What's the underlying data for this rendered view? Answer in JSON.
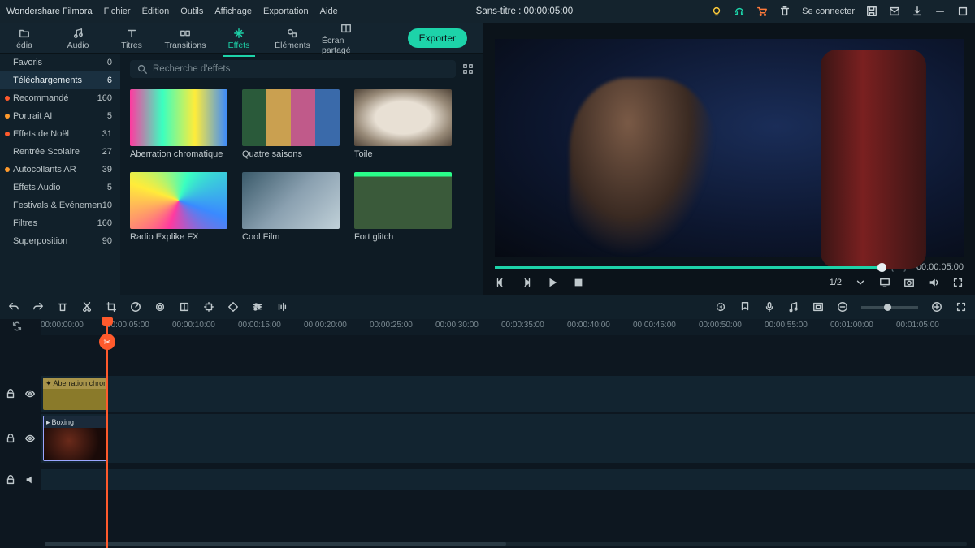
{
  "titlebar": {
    "app_name": "Wondershare Filmora",
    "menu": [
      "Fichier",
      "Édition",
      "Outils",
      "Affichage",
      "Exportation",
      "Aide"
    ],
    "doc_title": "Sans-titre : 00:00:05:00",
    "connect_label": "Se connecter"
  },
  "media_tabs": [
    {
      "label": "édia",
      "icon": "folder"
    },
    {
      "label": "Audio",
      "icon": "music"
    },
    {
      "label": "Titres",
      "icon": "text"
    },
    {
      "label": "Transitions",
      "icon": "transition"
    },
    {
      "label": "Effets",
      "icon": "sparkle",
      "active": true
    },
    {
      "label": "Éléments",
      "icon": "shapes"
    },
    {
      "label": "Écran partagé",
      "icon": "split"
    }
  ],
  "export_label": "Exporter",
  "search_placeholder": "Recherche d'effets",
  "sidebar": [
    {
      "label": "Favoris",
      "count": 0
    },
    {
      "label": "Téléchargements",
      "count": 6,
      "active": true
    },
    {
      "label": "Recommandé",
      "count": 160,
      "dot": "#ff5a2c"
    },
    {
      "label": "Portrait AI",
      "count": 5,
      "dot": "#ff9a2c"
    },
    {
      "label": "Effets de Noël",
      "count": 31,
      "dot": "#ff5a2c"
    },
    {
      "label": "Rentrée Scolaire",
      "count": 27
    },
    {
      "label": "Autocollants AR",
      "count": 39,
      "dot": "#ff9a2c"
    },
    {
      "label": "Effets Audio",
      "count": 5
    },
    {
      "label": "Festivals & Événemen",
      "count": 10
    },
    {
      "label": "Filtres",
      "count": 160
    },
    {
      "label": "Superposition",
      "count": 90
    }
  ],
  "effects": [
    {
      "label": "Aberration chromatique",
      "thumb": "linear-gradient(90deg,#ff3aa0,#3affc0,#ffec3a,#3a8aff)"
    },
    {
      "label": "Quatre saisons",
      "thumb": "linear-gradient(90deg,#2a5a3a 0 25%,#caa050 25% 50%,#c05a8a 50% 75%,#3a6aaa 75%)"
    },
    {
      "label": "Toile",
      "thumb": "radial-gradient(ellipse,#e8e0d4 40%,#988a78 70%,#504438)"
    },
    {
      "label": "Radio Explike FX",
      "thumb": "conic-gradient(from 200deg,#ff3aa0,#ffec3a,#3affc0,#3a8aff,#ff3aa0)"
    },
    {
      "label": "Cool Film",
      "thumb": "linear-gradient(135deg,#3a5a6a,#8aa0b0,#c0d0d8)"
    },
    {
      "label": "Fort glitch",
      "thumb": "linear-gradient(180deg,#2aff8a 0 8%,#3a5a3a 8% 100%)"
    }
  ],
  "preview": {
    "time_display": "00:00:05:00",
    "scale": "1/2"
  },
  "timeline": {
    "ticks": [
      "00:00:00:00",
      "00:00:05:00",
      "00:00:10:00",
      "00:00:15:00",
      "00:00:20:00",
      "00:00:25:00",
      "00:00:30:00",
      "00:00:35:00",
      "00:00:40:00",
      "00:00:45:00",
      "00:00:50:00",
      "00:00:55:00",
      "00:01:00:00",
      "00:01:05:00"
    ],
    "effect_clip": "Aberration chrom",
    "video_clip": "Boxing"
  }
}
